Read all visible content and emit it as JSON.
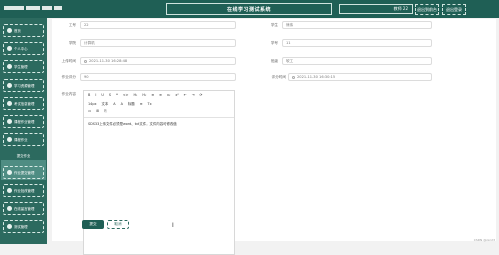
{
  "header": {
    "title": "在线学习测试系统",
    "user_label": "教师 22",
    "btn_front": "退出到前台",
    "btn_logout": "退出登录"
  },
  "sidebar": {
    "items": [
      "首页",
      "个人中心",
      "学生管理",
      "学习资源管理",
      "考试信息管理",
      "课程作业管理",
      "课程作业",
      "作业提交管理",
      "作业批改管理",
      "在线留言管理",
      "测试管理"
    ],
    "active_sub": "提交作业"
  },
  "form": {
    "labels": {
      "gonghao": "工号",
      "xueyuan": "学院",
      "shangchuan": "上传时间",
      "zongfen": "作业评分",
      "zuoye": "作业内容",
      "xuesheng": "学生",
      "xuehao": "学号",
      "banji": "班级",
      "pingfen_time": "评分时间"
    },
    "values": {
      "gonghao": "22",
      "xueyuan": "计算机",
      "shangchuan": "2021-11-30 16:28:48",
      "zongfen": "90",
      "xuesheng": "熊伟",
      "xuehao": "11",
      "banji": "软工",
      "pingfen_time": "2021-11-30 16:30:15"
    }
  },
  "editor": {
    "toolbar_row1": [
      "B",
      "I",
      "U",
      "S",
      "❝",
      "<>",
      "H₁",
      "H₂",
      "≡",
      "≡",
      "x₂",
      "x²",
      "⇤",
      "⇥",
      "⟳"
    ],
    "toolbar_row2": [
      "14px",
      "文本",
      "A",
      "A",
      "标题",
      "≡",
      "Tx"
    ],
    "toolbar_row3": [
      "▭",
      "⊞",
      "⎘"
    ],
    "content": "SDS33上传文件必须是word、txt文件，文件内容可修改值"
  },
  "actions": {
    "submit": "提交",
    "cancel": "取消"
  },
  "footer": "CSDN @zxc23"
}
